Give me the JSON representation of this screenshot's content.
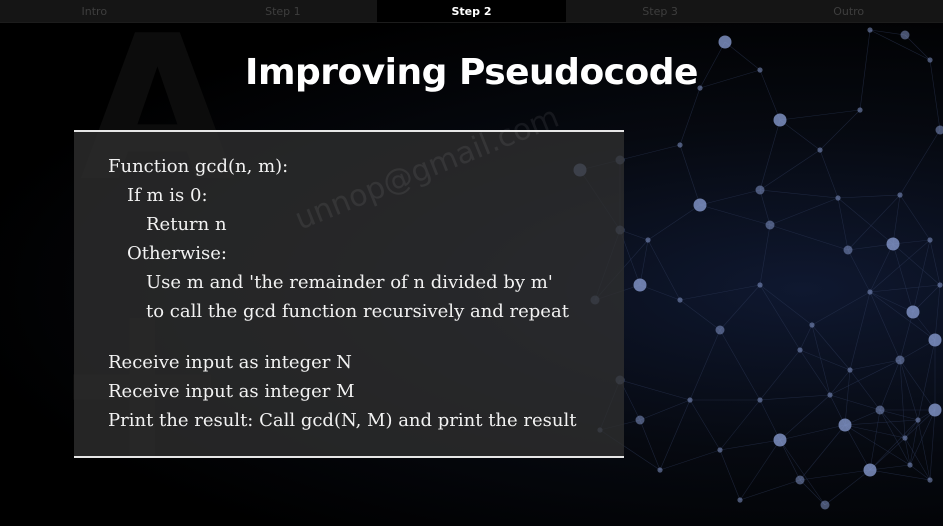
{
  "nav": {
    "steps": [
      "Intro",
      "Step 1",
      "Step 2",
      "Step 3",
      "Outro"
    ],
    "active_step": "Step 2"
  },
  "slide": {
    "title": "Improving Pseudocode",
    "watermark": "unnop@gmail.com",
    "code_lines": [
      "Function gcd(n, m):",
      "If m is 0:",
      "Return n",
      "Otherwise:",
      "Use m and 'the remainder of n divided by m'",
      "to call the gcd function recursively and repeat",
      "Receive input as integer N",
      "Receive input as integer M",
      "Print the result: Call gcd(N, M) and print the result"
    ]
  },
  "colors": {
    "background": "#000000",
    "panel": "#303030",
    "panel_border": "#e6e6e6",
    "text": "#f2f2f2",
    "network_node": "#8ea2d8"
  }
}
